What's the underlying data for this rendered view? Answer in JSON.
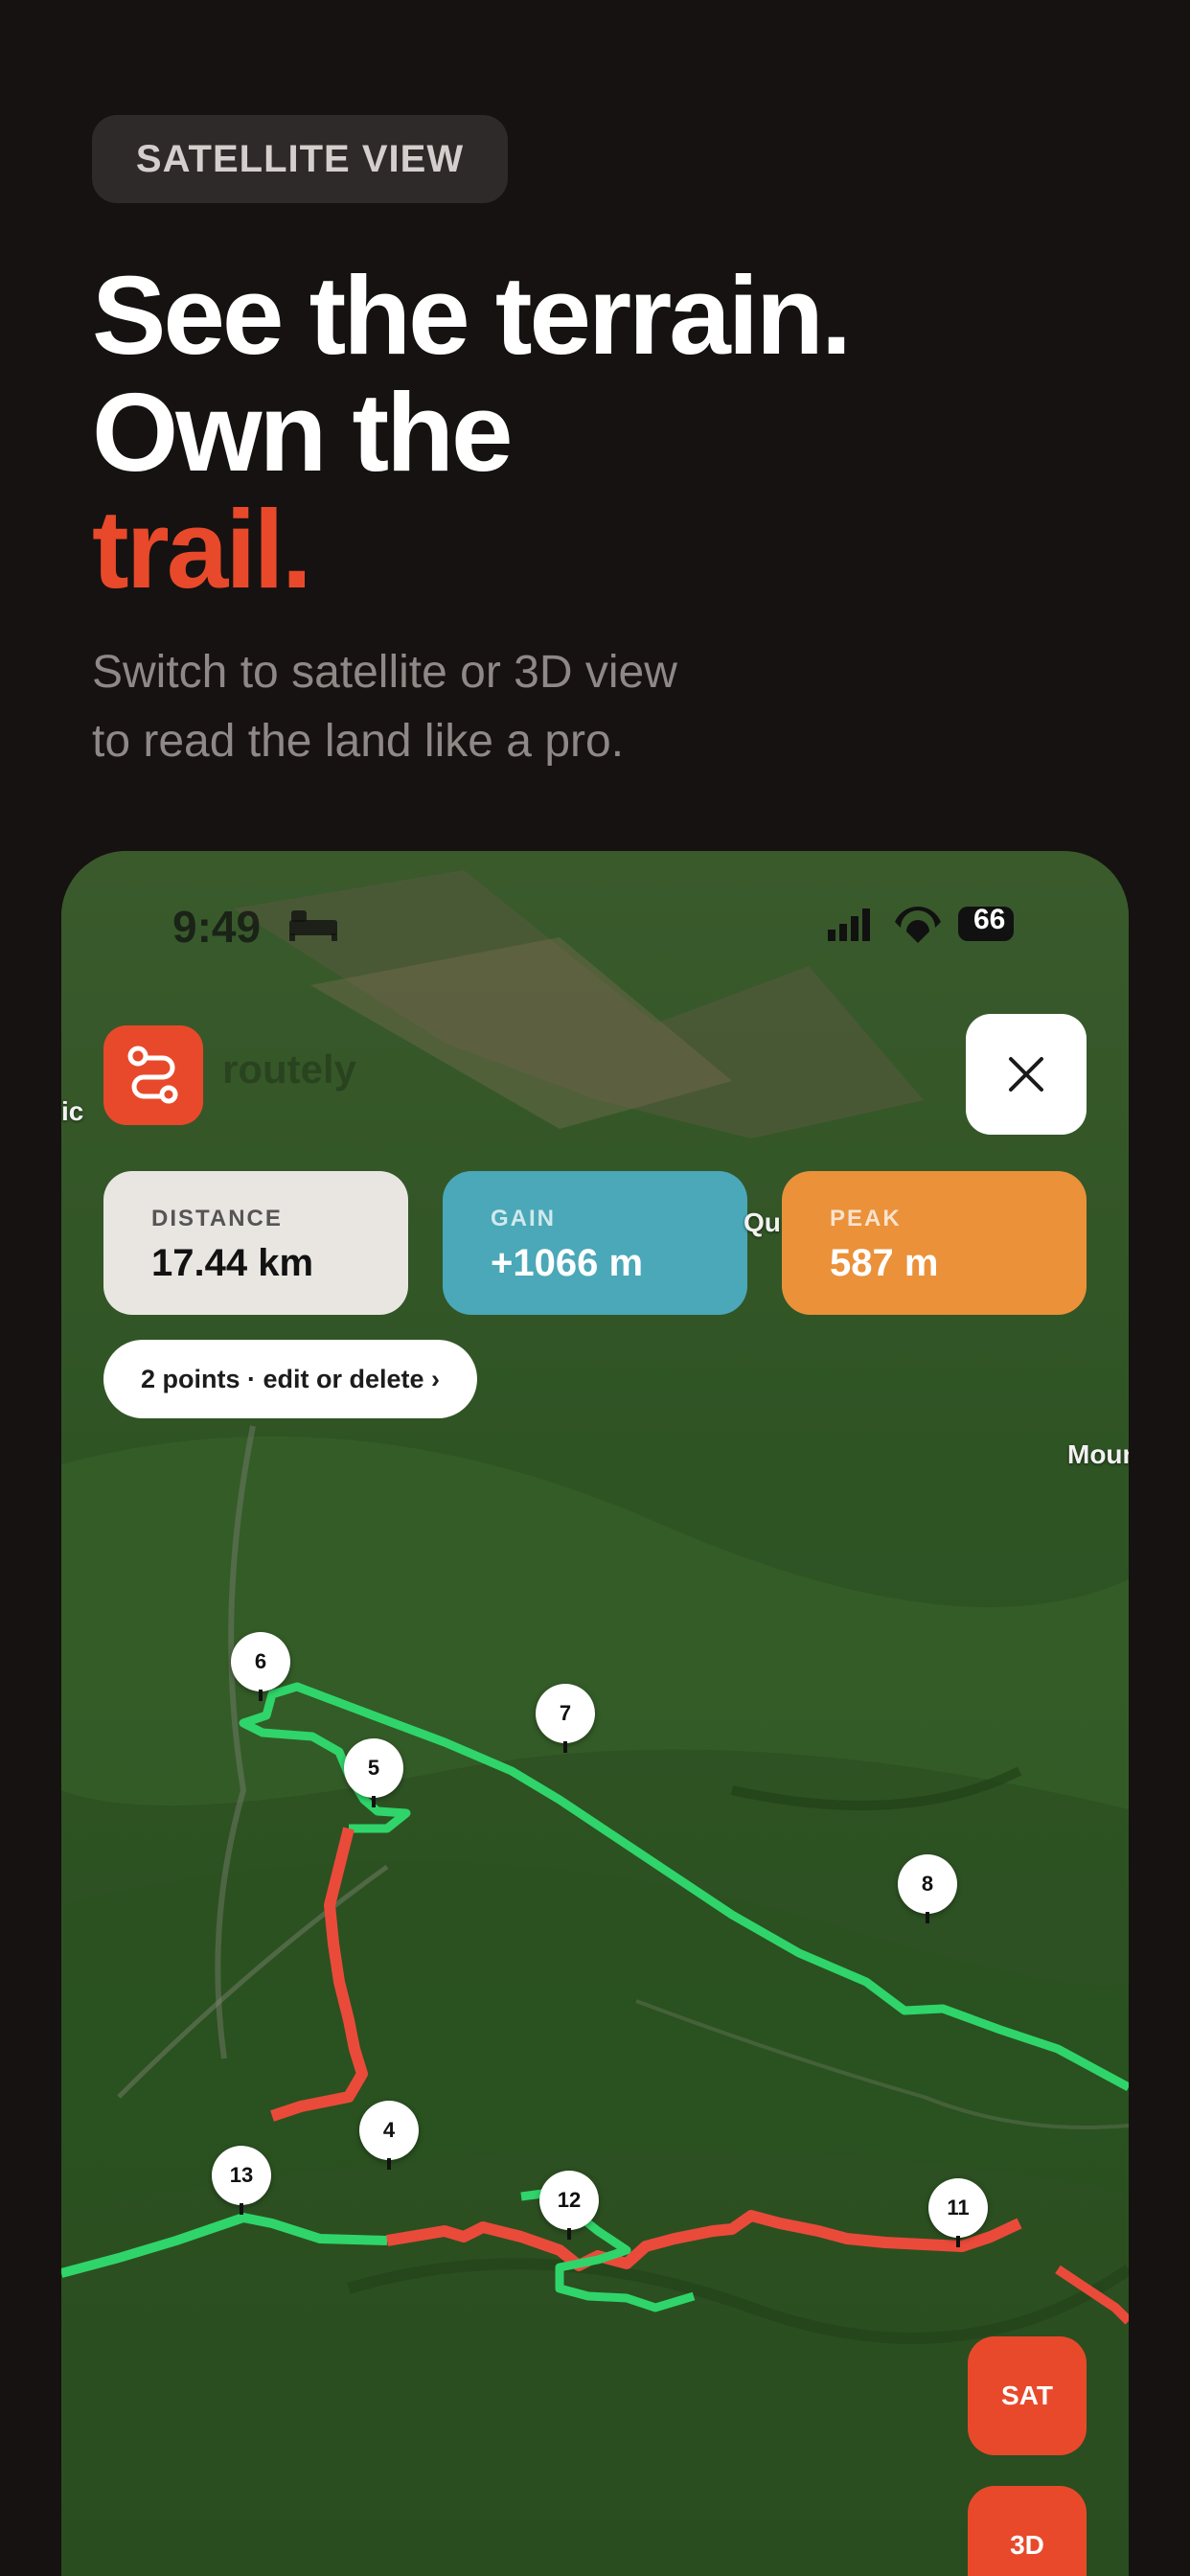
{
  "header": {
    "badge": "SATELLITE VIEW",
    "headline_line1": "See the terrain.",
    "headline_line2": "Own the",
    "headline_line3": "trail.",
    "subtitle_line1": "Switch to satellite or 3D view",
    "subtitle_line2": "to read the land like a pro."
  },
  "phone": {
    "status": {
      "time": "9:49",
      "battery": "66"
    },
    "app_name": "routely",
    "stats": {
      "distance_label": "DISTANCE",
      "distance_value": "17.44 km",
      "gain_label": "GAIN",
      "gain_value": "+1066 m",
      "peak_label": "PEAK",
      "peak_value": "587 m"
    },
    "points_pill": "2 points · edit or delete ›",
    "map_labels": {
      "left_edge": "ic",
      "qu": "Qu",
      "mount": "Moun"
    },
    "waypoints": [
      "6",
      "7",
      "5",
      "8",
      "4",
      "13",
      "12",
      "11"
    ],
    "buttons": {
      "sat": "SAT",
      "three_d": "3D"
    }
  },
  "colors": {
    "accent": "#e8492b",
    "gain": "#4aa8b8",
    "peak": "#ea913a",
    "route_green": "#2fd56a",
    "route_red": "#ea4a3a"
  }
}
